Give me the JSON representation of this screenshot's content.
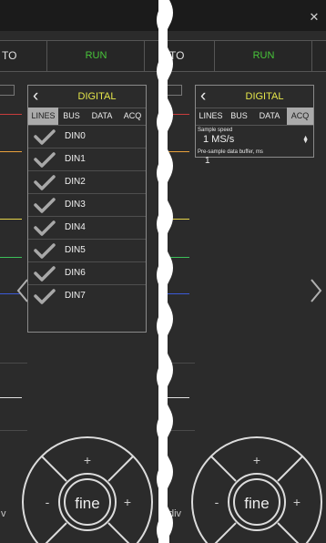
{
  "left_panel": {
    "mode_label": "TO",
    "run_label": "RUN",
    "digital_title": "DIGITAL",
    "tabs": [
      "LINES",
      "BUS",
      "DATA",
      "ACQ"
    ],
    "active_tab": "LINES",
    "lines": [
      {
        "label": "DIN0",
        "checked": true
      },
      {
        "label": "DIN1",
        "checked": true
      },
      {
        "label": "DIN2",
        "checked": true
      },
      {
        "label": "DIN3",
        "checked": true
      },
      {
        "label": "DIN4",
        "checked": true
      },
      {
        "label": "DIN5",
        "checked": true
      },
      {
        "label": "DIN6",
        "checked": true
      },
      {
        "label": "DIN7",
        "checked": true
      }
    ],
    "dial_label": "fine",
    "div_label": "v"
  },
  "right_panel": {
    "mode_label": "TO",
    "run_label": "RUN",
    "digital_title": "DIGITAL",
    "tabs": [
      "LINES",
      "BUS",
      "DATA",
      "ACQ"
    ],
    "active_tab": "ACQ",
    "sample_speed_label": "Sample speed",
    "sample_speed_value": "1 MS/s",
    "pre_sample_label": "Pre-sample data buffer, ms",
    "pre_sample_value": "1",
    "dial_label": "fine",
    "div_label": "div"
  },
  "icons": {
    "close": "close-icon",
    "back": "chevron-left-icon",
    "check": "check-icon",
    "nav_prev": "chevron-left-icon",
    "nav_next": "chevron-right-icon",
    "stepper": "up-down-arrows-icon"
  },
  "colors": {
    "background": "#2b2b2b",
    "run": "#49c53a",
    "title": "#e5e64a",
    "active_tab": "#aaaaaa",
    "trace_red": "#c83c3c",
    "trace_orange": "#e8a03c",
    "trace_yellow": "#e6d44a",
    "trace_green": "#3cc05a",
    "trace_blue": "#3c5ad8"
  }
}
